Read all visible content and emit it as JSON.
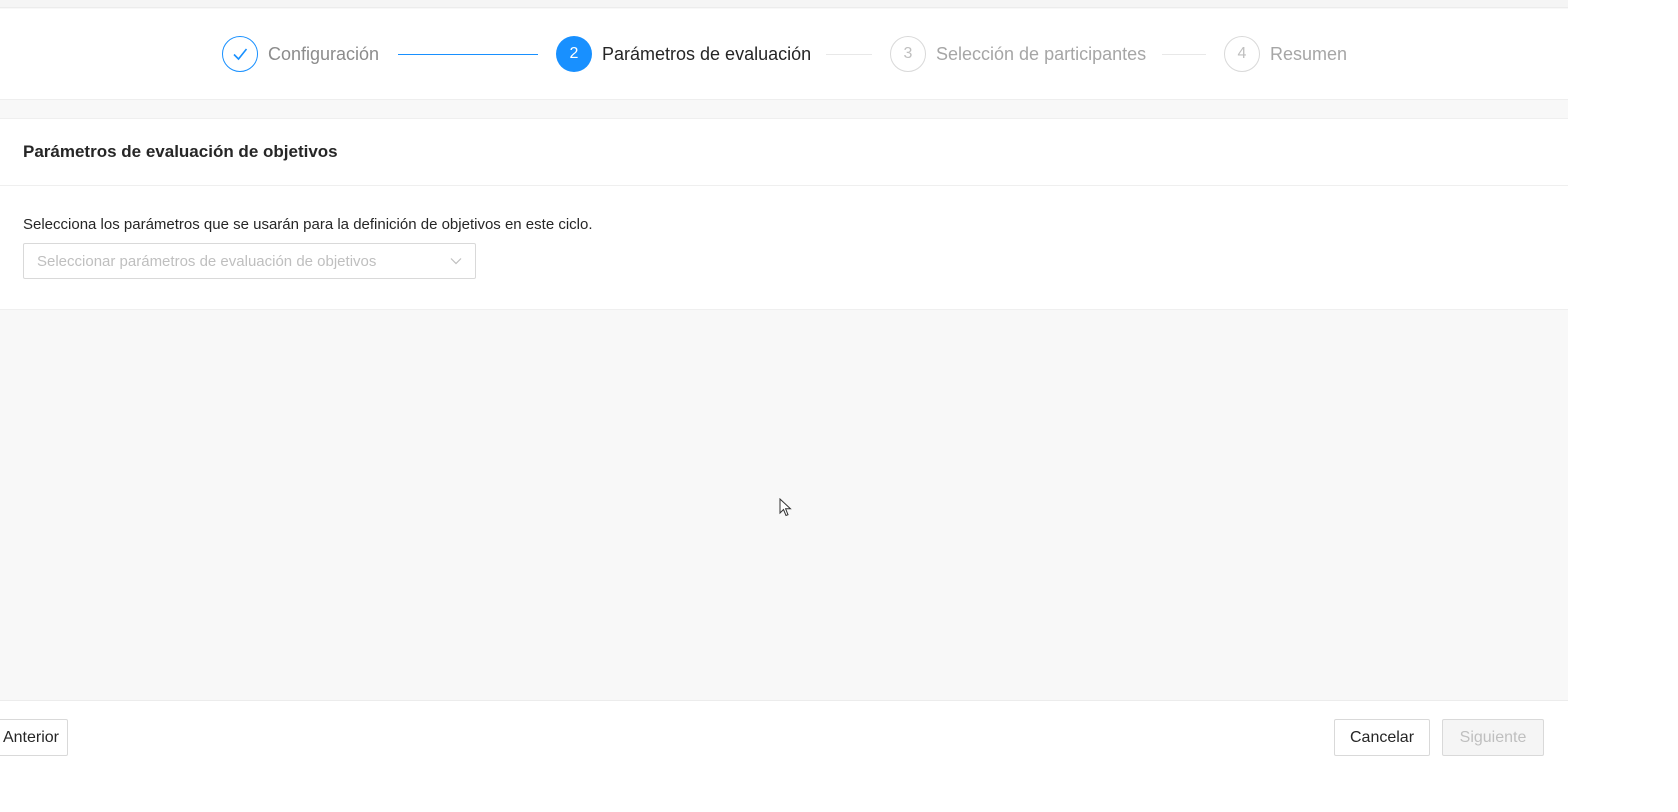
{
  "steps": [
    {
      "number": "1",
      "label": "Configuración",
      "status": "done",
      "icon": "check-icon"
    },
    {
      "number": "2",
      "label": "Parámetros de evaluación",
      "status": "active"
    },
    {
      "number": "3",
      "label": "Selección de participantes",
      "status": "wait"
    },
    {
      "number": "4",
      "label": "Resumen",
      "status": "wait"
    }
  ],
  "card": {
    "title": "Parámetros de evaluación de objetivos",
    "description": "Selecciona los parámetros que se usarán para la definición de objetivos en este ciclo.",
    "select": {
      "placeholder": "Seleccionar parámetros de evaluación de objetivos",
      "icon": "chevron-down-icon"
    }
  },
  "footer": {
    "prev_label": "Anterior",
    "cancel_label": "Cancelar",
    "next_label": "Siguiente"
  },
  "colors": {
    "accent": "#1890ff",
    "border": "#d9d9d9",
    "disabled_text": "#bfbfbf"
  }
}
